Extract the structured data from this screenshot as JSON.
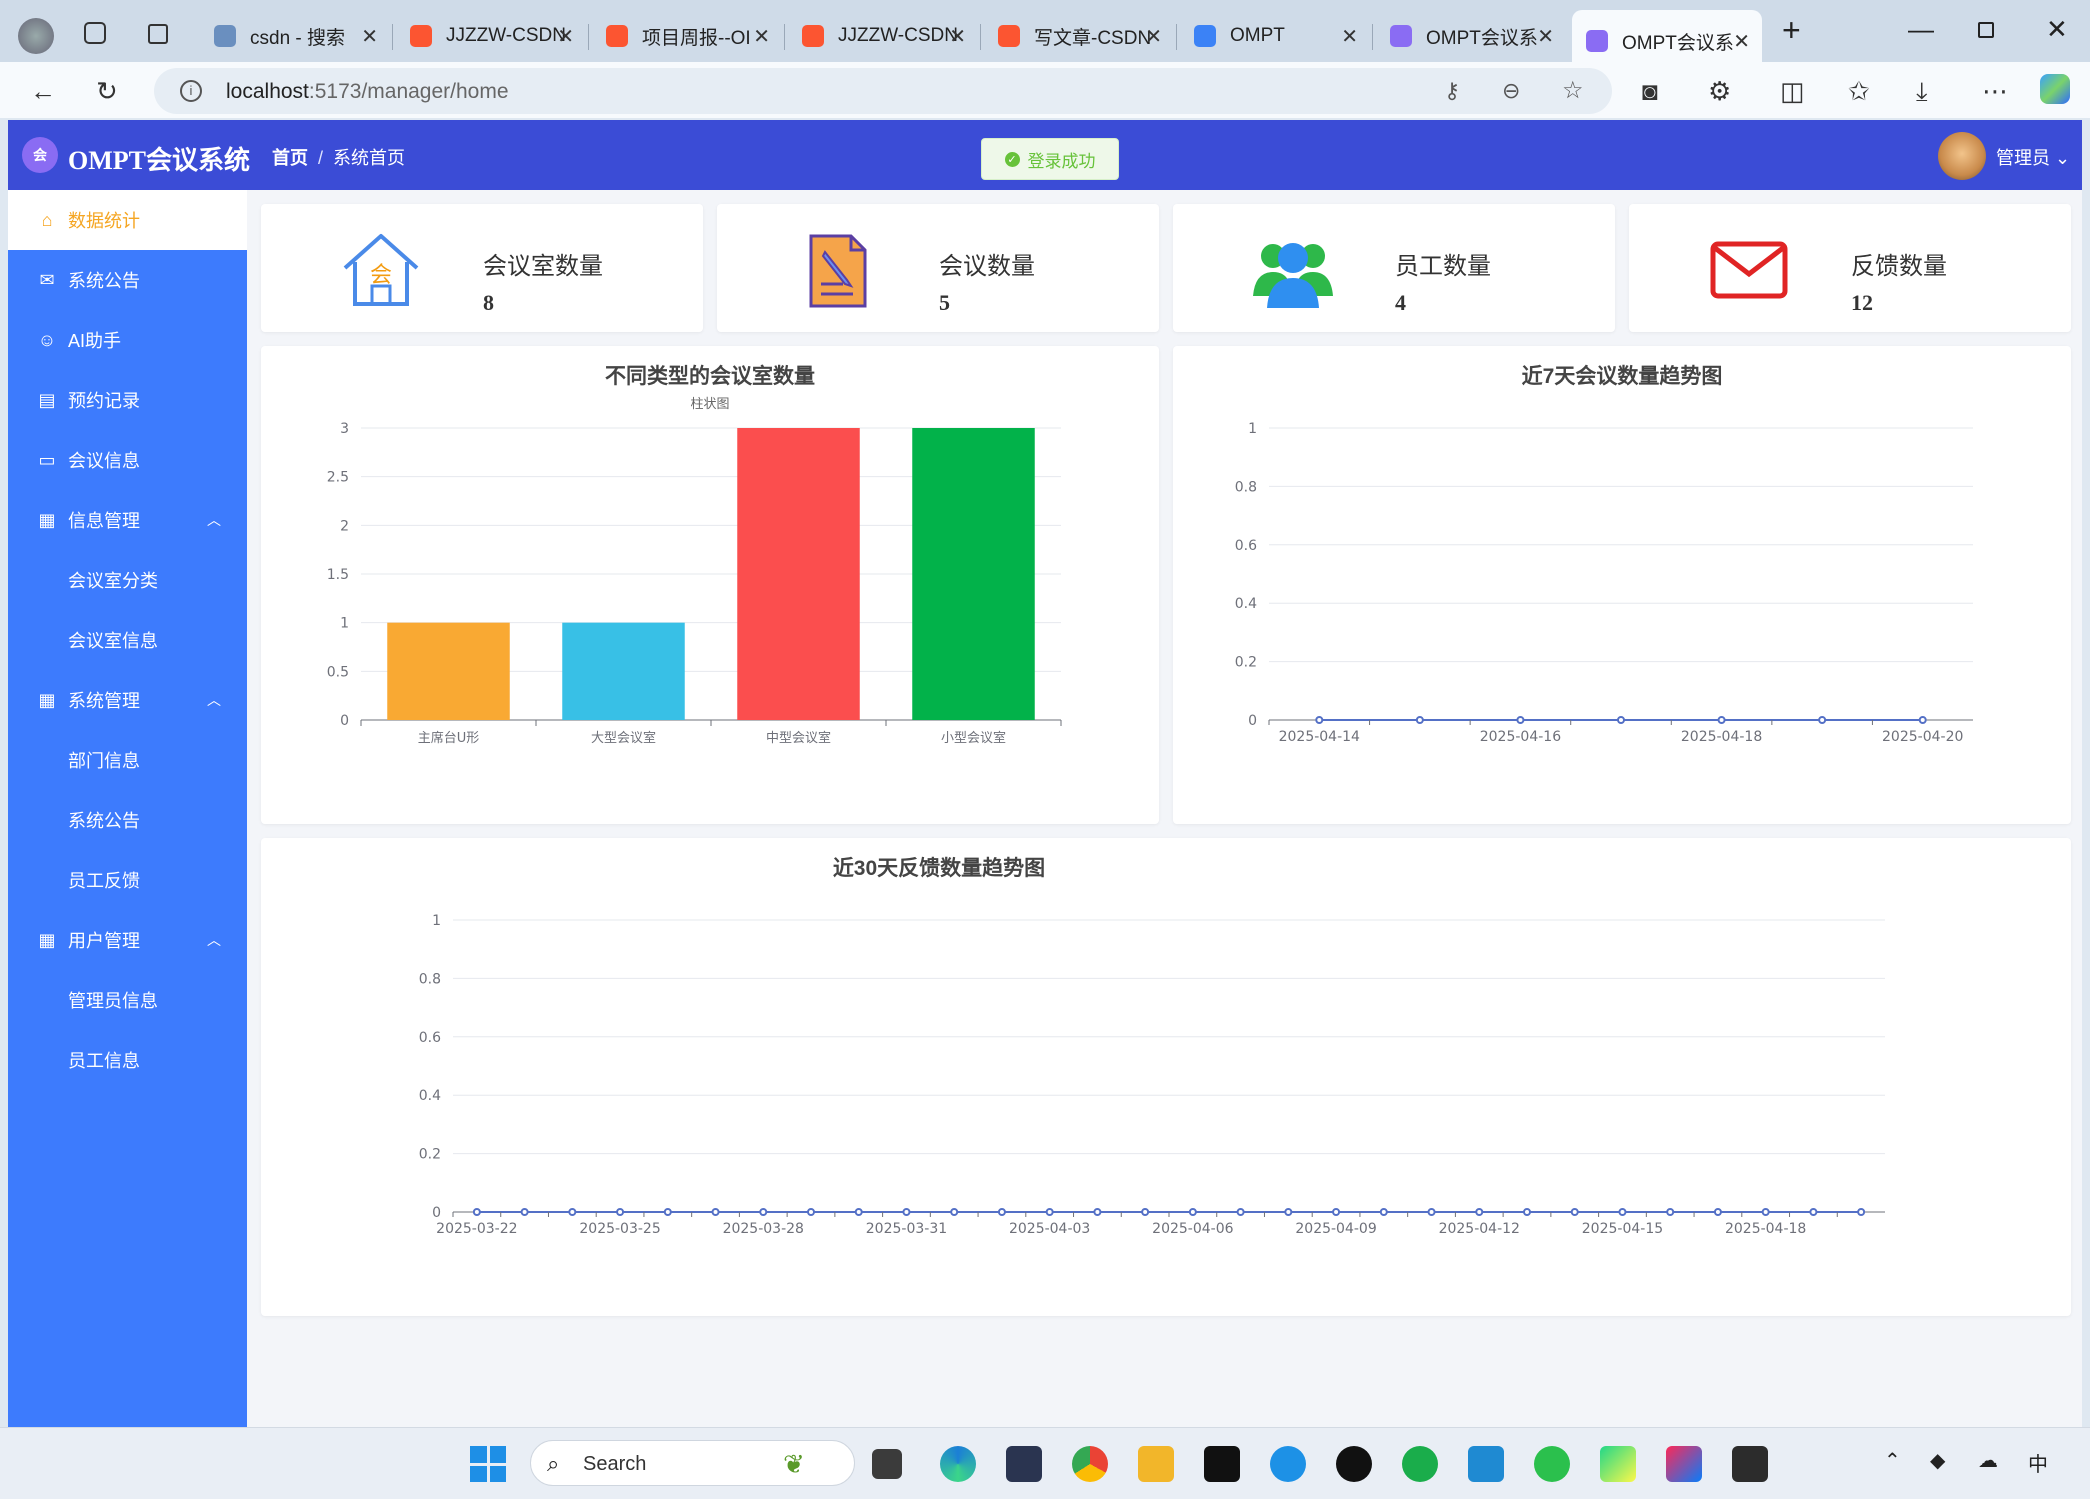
{
  "browser": {
    "tabs": [
      {
        "title": "csdn - 搜索",
        "icon": "search-icon",
        "color": "#6a8fbf"
      },
      {
        "title": "JJZZW-CSDN",
        "icon": "csdn-icon",
        "color": "#fc5531"
      },
      {
        "title": "项目周报--OI",
        "icon": "csdn-icon",
        "color": "#fc5531"
      },
      {
        "title": "JJZZW-CSDN",
        "icon": "csdn-icon",
        "color": "#fc5531"
      },
      {
        "title": "写文章-CSDN",
        "icon": "csdn-icon",
        "color": "#fc5531"
      },
      {
        "title": "OMPT",
        "icon": "app-icon",
        "color": "#3b82f6"
      },
      {
        "title": "OMPT会议系",
        "icon": "ompt-icon",
        "color": "#8a6cf3"
      },
      {
        "title": "OMPT会议系",
        "icon": "ompt-icon",
        "color": "#8a6cf3"
      }
    ],
    "url_host": "localhost",
    "url_rest": ":5173/manager/home"
  },
  "header": {
    "app_title": "OMPT会议系统",
    "logo_text": "会",
    "breadcrumb_home": "首页",
    "breadcrumb_sep": "/",
    "breadcrumb_current": "系统首页",
    "toast": "登录成功",
    "user_name": "管理员"
  },
  "sidebar": {
    "items": [
      {
        "label": "数据统计",
        "icon": "home-icon",
        "active": true
      },
      {
        "label": "系统公告",
        "icon": "mail-icon"
      },
      {
        "label": "AI助手",
        "icon": "chat-icon"
      },
      {
        "label": "预约记录",
        "icon": "document-icon"
      },
      {
        "label": "会议信息",
        "icon": "briefcase-icon"
      },
      {
        "label": "信息管理",
        "icon": "grid-icon",
        "group": true
      },
      {
        "label": "会议室分类",
        "sub": true
      },
      {
        "label": "会议室信息",
        "sub": true
      },
      {
        "label": "系统管理",
        "icon": "grid-icon",
        "group": true
      },
      {
        "label": "部门信息",
        "sub": true
      },
      {
        "label": "系统公告",
        "sub": true
      },
      {
        "label": "员工反馈",
        "sub": true
      },
      {
        "label": "用户管理",
        "icon": "grid-icon",
        "group": true
      },
      {
        "label": "管理员信息",
        "sub": true
      },
      {
        "label": "员工信息",
        "sub": true
      }
    ]
  },
  "stats": [
    {
      "label": "会议室数量",
      "value": "8",
      "icon": "meeting-room-icon"
    },
    {
      "label": "会议数量",
      "value": "5",
      "icon": "meeting-doc-icon"
    },
    {
      "label": "员工数量",
      "value": "4",
      "icon": "employees-icon"
    },
    {
      "label": "反馈数量",
      "value": "12",
      "icon": "feedback-mail-icon"
    }
  ],
  "chart_data": [
    {
      "type": "bar",
      "title": "不同类型的会议室数量",
      "subtitle": "柱状图",
      "categories": [
        "主席台U形",
        "大型会议室",
        "中型会议室",
        "小型会议室"
      ],
      "values": [
        1,
        1,
        3,
        3
      ],
      "colors": [
        "#f9a933",
        "#38c0e6",
        "#fb4e4e",
        "#02b24a"
      ],
      "ylim": [
        0,
        3
      ],
      "yticks": [
        "0",
        "0.5",
        "1",
        "1.5",
        "2",
        "2.5",
        "3"
      ],
      "grid": true
    },
    {
      "type": "line",
      "title": "近7天会议数量趋势图",
      "x": [
        "2025-04-14",
        "2025-04-15",
        "2025-04-16",
        "2025-04-17",
        "2025-04-18",
        "2025-04-19",
        "2025-04-20"
      ],
      "xlabels": [
        "2025-04-14",
        "2025-04-16",
        "2025-04-18",
        "2025-04-20"
      ],
      "values": [
        0,
        0,
        0,
        0,
        0,
        0,
        0
      ],
      "ylim": [
        0,
        1
      ],
      "yticks": [
        "0",
        "0.2",
        "0.4",
        "0.6",
        "0.8",
        "1"
      ],
      "color": "#5470c6",
      "grid": true
    },
    {
      "type": "line",
      "title": "近30天反馈数量趋势图",
      "x": [
        "2025-03-22",
        "2025-03-23",
        "2025-03-24",
        "2025-03-25",
        "2025-03-26",
        "2025-03-27",
        "2025-03-28",
        "2025-03-29",
        "2025-03-30",
        "2025-03-31",
        "2025-04-01",
        "2025-04-02",
        "2025-04-03",
        "2025-04-04",
        "2025-04-05",
        "2025-04-06",
        "2025-04-07",
        "2025-04-08",
        "2025-04-09",
        "2025-04-10",
        "2025-04-11",
        "2025-04-12",
        "2025-04-13",
        "2025-04-14",
        "2025-04-15",
        "2025-04-16",
        "2025-04-17",
        "2025-04-18",
        "2025-04-19",
        "2025-04-20"
      ],
      "xlabels": [
        "2025-03-22",
        "2025-03-25",
        "2025-03-28",
        "2025-03-31",
        "2025-04-03",
        "2025-04-06",
        "2025-04-09",
        "2025-04-12",
        "2025-04-15",
        "2025-04-18"
      ],
      "values": [
        0,
        0,
        0,
        0,
        0,
        0,
        0,
        0,
        0,
        0,
        0,
        0,
        0,
        0,
        0,
        0,
        0,
        0,
        0,
        0,
        0,
        0,
        0,
        0,
        0,
        0,
        0,
        0,
        0,
        0
      ],
      "ylim": [
        0,
        1
      ],
      "yticks": [
        "0",
        "0.2",
        "0.4",
        "0.6",
        "0.8",
        "1"
      ],
      "color": "#5470c6",
      "grid": true
    }
  ],
  "taskbar": {
    "search_placeholder": "Search",
    "tray_lang": "中"
  }
}
